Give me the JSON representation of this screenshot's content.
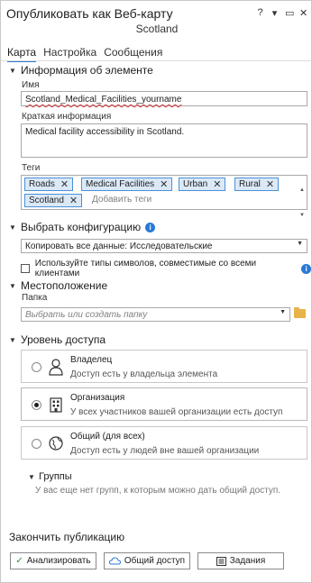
{
  "header": {
    "title": "Опубликовать как Веб-карту",
    "subtitle": "Scotland",
    "controls": [
      "?",
      "▾",
      "▭",
      "✕"
    ]
  },
  "tabs": [
    {
      "label": "Карта",
      "active": true
    },
    {
      "label": "Настройка",
      "active": false
    },
    {
      "label": "Сообщения",
      "active": false
    }
  ],
  "item_info": {
    "heading": "Информация об элементе",
    "name_label": "Имя",
    "name_value": "Scotland_Medical_Facilities_yourname",
    "summary_label": "Краткая информация",
    "summary_value": "Medical facility accessibility in Scotland.",
    "tags_label": "Теги",
    "tags": [
      "Roads",
      "Medical Facilities",
      "Urban",
      "Rural",
      "Scotland"
    ],
    "tags_placeholder": "Добавить теги"
  },
  "configuration": {
    "heading": "Выбрать конфигурацию",
    "selected": "Копировать все данные: Исследовательские",
    "checkbox_label": "Используйте типы символов, совместимые со всеми клиентами"
  },
  "location": {
    "heading": "Местоположение",
    "folder_label": "Папка",
    "folder_placeholder": "Выбрать или создать папку"
  },
  "access": {
    "heading": "Уровень доступа",
    "options": [
      {
        "title": "Владелец",
        "desc": "Доступ есть у владельца элемента",
        "selected": false,
        "icon": "person-icon"
      },
      {
        "title": "Организация",
        "desc": "У всех участников вашей организации есть доступ",
        "selected": true,
        "icon": "organization-icon"
      },
      {
        "title": "Общий (для всех)",
        "desc": "Доступ есть у людей вне вашей организации",
        "selected": false,
        "icon": "globe-icon"
      }
    ],
    "groups_heading": "Группы",
    "groups_desc": "У вас еще нет групп, к которым можно дать общий доступ."
  },
  "finish": {
    "heading": "Закончить публикацию",
    "analyze_label": "Анализировать",
    "share_label": "Общий доступ",
    "jobs_label": "Задания"
  },
  "colors": {
    "accent": "#2a7ad5",
    "tag_bg": "#dbe9f7",
    "tag_border": "#4a90d9",
    "analyze_check": "#2e8b3a"
  }
}
